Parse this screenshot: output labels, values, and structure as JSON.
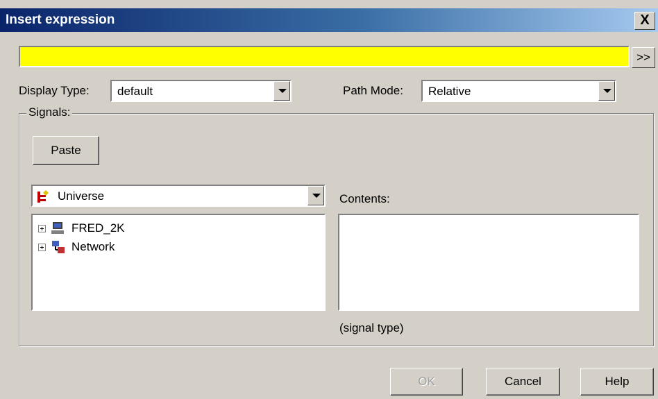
{
  "window": {
    "title": "Insert expression",
    "close_symbol": "X"
  },
  "expression": {
    "value": "",
    "expand_label": ">>"
  },
  "display_type": {
    "label": "Display Type:",
    "value": "default"
  },
  "path_mode": {
    "label": "Path Mode:",
    "value": "Relative"
  },
  "signals": {
    "group_label": "Signals:",
    "paste_label": "Paste",
    "source": {
      "value": "Universe",
      "icon": "universe-icon"
    },
    "tree": [
      {
        "label": "FRED_2K",
        "icon": "computer-icon"
      },
      {
        "label": "Network",
        "icon": "network-icon"
      }
    ],
    "contents_label": "Contents:",
    "signal_type": "(signal type)"
  },
  "buttons": {
    "ok": "OK",
    "cancel": "Cancel",
    "help": "Help"
  },
  "colors": {
    "expression_bg": "#ffff00",
    "title_start": "#0a246a",
    "title_end": "#a6caf0",
    "dialog_bg": "#d4d0c8"
  }
}
